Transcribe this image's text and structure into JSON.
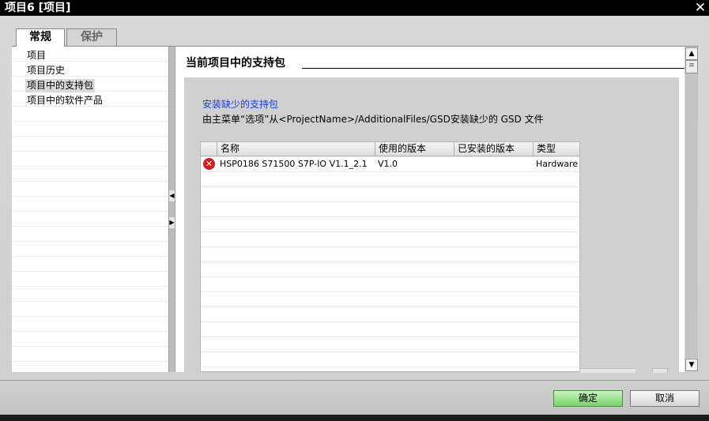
{
  "window": {
    "title": "项目6 [项目]",
    "close_label": "✕"
  },
  "tabs": [
    {
      "label": "常规",
      "active": true
    },
    {
      "label": "保护",
      "active": false
    }
  ],
  "nav": {
    "items": [
      {
        "label": "项目",
        "selected": false
      },
      {
        "label": "项目历史",
        "selected": false
      },
      {
        "label": "项目中的支持包",
        "selected": true
      },
      {
        "label": "项目中的软件产品",
        "selected": false
      }
    ]
  },
  "section": {
    "title": "当前项目中的支持包",
    "install_link": "安装缺少的支持包",
    "description": "由主菜单“选项”从<ProjectName>/AdditionalFiles/GSD安装缺少的 GSD 文件"
  },
  "table": {
    "columns": [
      "名称",
      "使用的版本",
      "已安装的版本",
      "类型"
    ],
    "rows": [
      {
        "status": "error",
        "name": "HSP0186 S71500 S7P-IO V1.1_2.1",
        "used_version": "V1.0",
        "installed_version": "",
        "type": "Hardware"
      }
    ]
  },
  "buttons": {
    "ok": "确定",
    "cancel": "取消"
  },
  "colors": {
    "link": "#1a3ee0",
    "ok_button": "#78d46a",
    "error": "#d71a1a"
  }
}
